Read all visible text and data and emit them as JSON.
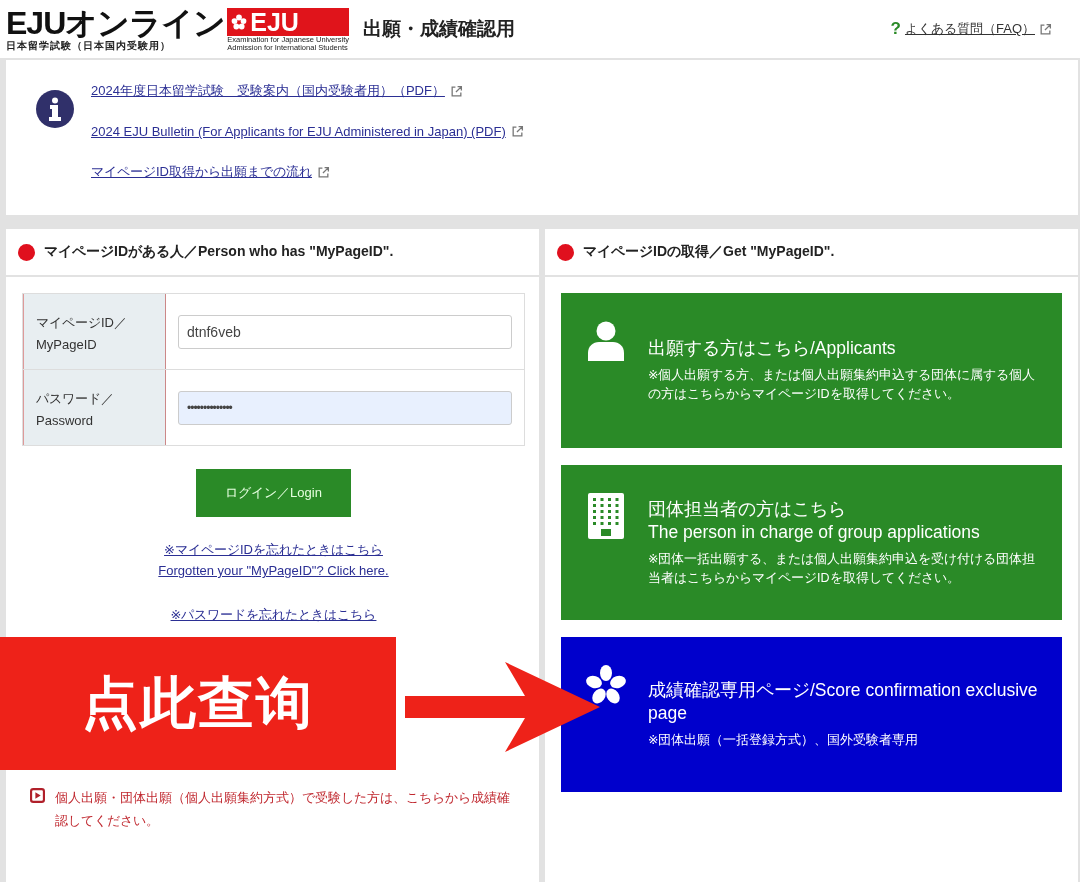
{
  "header": {
    "logo": {
      "title": "EJUオンライン",
      "subtitle": "日本留学試験（日本国内受験用）",
      "badge": "EJU",
      "badge_caption": [
        "Examination for Japanese University",
        "Admission for International Students"
      ]
    },
    "page_title": "出願・成績確認用",
    "faq_mark": "?",
    "faq_link": "よくある質問（FAQ）"
  },
  "info_links": [
    {
      "text": "2024年度日本留学試験　受験案内（国内受験者用）（PDF）"
    },
    {
      "text": "2024 EJU Bulletin (For Applicants for EJU Administered in Japan) (PDF)"
    },
    {
      "text": "マイページID取得から出願までの流れ"
    }
  ],
  "login_panel": {
    "heading": "マイページIDがある人／Person who has \"MyPageID\".",
    "fields": [
      {
        "kind": "text",
        "label_lines": [
          "マイページID／",
          "MyPageID"
        ],
        "value": "dtnf6veb",
        "autofilled": false
      },
      {
        "kind": "password",
        "label_lines": [
          "パスワード／",
          "Password"
        ],
        "value": "••••••••••••••",
        "autofilled": true
      }
    ],
    "login_button": "ログイン／Login",
    "forgot_id_links": [
      "※マイページIDを忘れたときはこちら",
      "Forgotten your \"MyPageID\"? Click here."
    ],
    "forgot_password_link": "※パスワードを忘れたときはこちら",
    "notice": "個人出願・団体出願（個人出願集約方式）で受験した方は、こちらから成績確認してください。"
  },
  "register_panel": {
    "heading": "マイページIDの取得／Get \"MyPageID\".",
    "cards": [
      {
        "kind": "person",
        "color": "#2a8a27",
        "title_lines": [
          "出願する方はこちら/Applicants"
        ],
        "note": "※個人出願する方、または個人出願集約申込する団体に属する個人の方はこちらからマイページIDを取得してください。"
      },
      {
        "kind": "building",
        "color": "#2a8a27",
        "title_lines": [
          "団体担当者の方はこちら",
          "The person in charge of group applications"
        ],
        "note": "※団体一括出願する、または個人出願集約申込を受け付ける団体担当者はこちらからマイページIDを取得してください。"
      },
      {
        "kind": "flower",
        "color": "#0000cc",
        "title_lines": [
          "成績確認専用ページ/Score confirmation exclusive page"
        ],
        "note": "※団体出願（一括登録方式）、国外受験者専用"
      }
    ]
  },
  "callout": {
    "text": "点此查询"
  }
}
